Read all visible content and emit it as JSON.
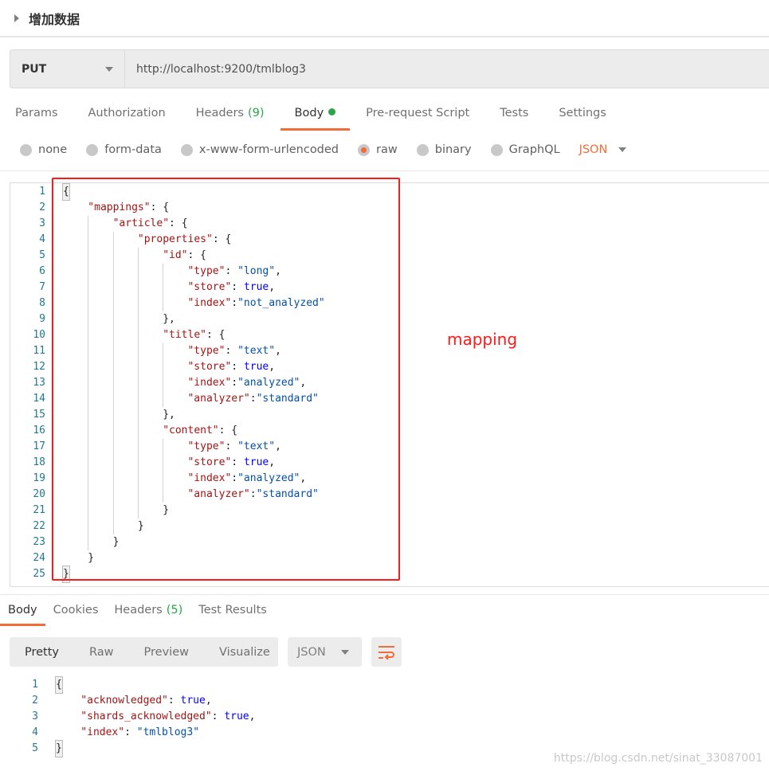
{
  "title": "增加数据",
  "request": {
    "method": "PUT",
    "url": "http://localhost:9200/tmlblog3",
    "tabs": [
      {
        "label": "Params"
      },
      {
        "label": "Authorization"
      },
      {
        "label": "Headers",
        "count": "(9)"
      },
      {
        "label": "Body",
        "active": true,
        "dot": true
      },
      {
        "label": "Pre-request Script"
      },
      {
        "label": "Tests"
      },
      {
        "label": "Settings"
      }
    ],
    "body_types": [
      {
        "label": "none"
      },
      {
        "label": "form-data"
      },
      {
        "label": "x-www-form-urlencoded"
      },
      {
        "label": "raw",
        "selected": true
      },
      {
        "label": "binary"
      },
      {
        "label": "GraphQL"
      }
    ],
    "format": "JSON",
    "code": [
      [
        0,
        [
          [
            "br",
            "{"
          ]
        ]
      ],
      [
        1,
        [
          [
            "k",
            "\"mappings\""
          ],
          [
            "p",
            ": {"
          ]
        ]
      ],
      [
        2,
        [
          [
            "k",
            "\"article\""
          ],
          [
            "p",
            ": {"
          ]
        ]
      ],
      [
        3,
        [
          [
            "k",
            "\"properties\""
          ],
          [
            "p",
            ": {"
          ]
        ]
      ],
      [
        4,
        [
          [
            "k",
            "\"id\""
          ],
          [
            "p",
            ": {"
          ]
        ]
      ],
      [
        5,
        [
          [
            "k",
            "\"type\""
          ],
          [
            "p",
            ": "
          ],
          [
            "s",
            "\"long\""
          ],
          [
            "p",
            ","
          ]
        ]
      ],
      [
        5,
        [
          [
            "k",
            "\"store\""
          ],
          [
            "p",
            ": "
          ],
          [
            "b",
            "true"
          ],
          [
            "p",
            ","
          ]
        ]
      ],
      [
        5,
        [
          [
            "k",
            "\"index\""
          ],
          [
            "p",
            ":"
          ],
          [
            "s",
            "\"not_analyzed\""
          ]
        ]
      ],
      [
        4,
        [
          [
            "p",
            "},"
          ]
        ]
      ],
      [
        4,
        [
          [
            "k",
            "\"title\""
          ],
          [
            "p",
            ": {"
          ]
        ]
      ],
      [
        5,
        [
          [
            "k",
            "\"type\""
          ],
          [
            "p",
            ": "
          ],
          [
            "s",
            "\"text\""
          ],
          [
            "p",
            ","
          ]
        ]
      ],
      [
        5,
        [
          [
            "k",
            "\"store\""
          ],
          [
            "p",
            ": "
          ],
          [
            "b",
            "true"
          ],
          [
            "p",
            ","
          ]
        ]
      ],
      [
        5,
        [
          [
            "k",
            "\"index\""
          ],
          [
            "p",
            ":"
          ],
          [
            "s",
            "\"analyzed\""
          ],
          [
            "p",
            ","
          ]
        ]
      ],
      [
        5,
        [
          [
            "k",
            "\"analyzer\""
          ],
          [
            "p",
            ":"
          ],
          [
            "s",
            "\"standard\""
          ]
        ]
      ],
      [
        4,
        [
          [
            "p",
            "},"
          ]
        ]
      ],
      [
        4,
        [
          [
            "k",
            "\"content\""
          ],
          [
            "p",
            ": {"
          ]
        ]
      ],
      [
        5,
        [
          [
            "k",
            "\"type\""
          ],
          [
            "p",
            ": "
          ],
          [
            "s",
            "\"text\""
          ],
          [
            "p",
            ","
          ]
        ]
      ],
      [
        5,
        [
          [
            "k",
            "\"store\""
          ],
          [
            "p",
            ": "
          ],
          [
            "b",
            "true"
          ],
          [
            "p",
            ","
          ]
        ]
      ],
      [
        5,
        [
          [
            "k",
            "\"index\""
          ],
          [
            "p",
            ":"
          ],
          [
            "s",
            "\"analyzed\""
          ],
          [
            "p",
            ","
          ]
        ]
      ],
      [
        5,
        [
          [
            "k",
            "\"analyzer\""
          ],
          [
            "p",
            ":"
          ],
          [
            "s",
            "\"standard\""
          ]
        ]
      ],
      [
        4,
        [
          [
            "p",
            "}"
          ]
        ]
      ],
      [
        3,
        [
          [
            "p",
            "}"
          ]
        ]
      ],
      [
        2,
        [
          [
            "p",
            "}"
          ]
        ]
      ],
      [
        1,
        [
          [
            "p",
            "}"
          ]
        ]
      ],
      [
        0,
        [
          [
            "br",
            "}"
          ]
        ]
      ]
    ]
  },
  "annotation": "mapping",
  "response": {
    "tabs": [
      {
        "label": "Body",
        "active": true
      },
      {
        "label": "Cookies"
      },
      {
        "label": "Headers",
        "count": "(5)"
      },
      {
        "label": "Test Results"
      }
    ],
    "views": [
      "Pretty",
      "Raw",
      "Preview",
      "Visualize"
    ],
    "selected_view": "Pretty",
    "format": "JSON",
    "code": [
      [
        0,
        [
          [
            "br",
            "{"
          ]
        ]
      ],
      [
        1,
        [
          [
            "k",
            "\"acknowledged\""
          ],
          [
            "p",
            ": "
          ],
          [
            "b",
            "true"
          ],
          [
            "p",
            ","
          ]
        ]
      ],
      [
        1,
        [
          [
            "k",
            "\"shards_acknowledged\""
          ],
          [
            "p",
            ": "
          ],
          [
            "b",
            "true"
          ],
          [
            "p",
            ","
          ]
        ]
      ],
      [
        1,
        [
          [
            "k",
            "\"index\""
          ],
          [
            "p",
            ": "
          ],
          [
            "s",
            "\"tmlblog3\""
          ]
        ]
      ],
      [
        0,
        [
          [
            "br",
            "}"
          ]
        ]
      ]
    ]
  },
  "watermark": "https://blog.csdn.net/sinat_33087001",
  "colors": {
    "accent": "#f26b3a",
    "green": "#2aa54a",
    "annotation": "#ff1a1a"
  },
  "icons": {
    "collapse": "triangle-right-icon",
    "dropdown": "chevron-down-icon",
    "wrap": "wrap-lines-icon"
  }
}
